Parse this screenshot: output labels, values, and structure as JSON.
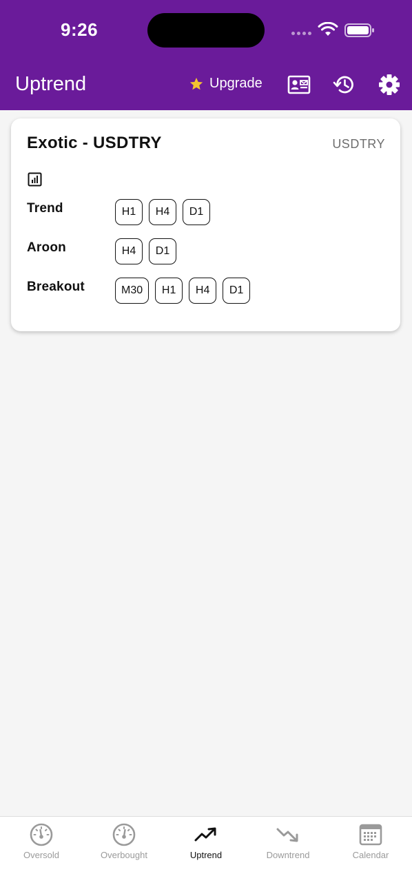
{
  "status_bar": {
    "time": "9:26"
  },
  "header": {
    "title": "Uptrend",
    "upgrade_label": "Upgrade",
    "icons": [
      "contact-card-icon",
      "history-icon",
      "gear-icon"
    ],
    "background_color": "#6a1b9a"
  },
  "card": {
    "title": "Exotic - USDTRY",
    "symbol": "USDTRY",
    "rows": [
      {
        "label": "Trend",
        "chips": [
          "H1",
          "H4",
          "D1"
        ]
      },
      {
        "label": "Aroon",
        "chips": [
          "H4",
          "D1"
        ]
      },
      {
        "label": "Breakout",
        "chips": [
          "M30",
          "H1",
          "H4",
          "D1"
        ]
      }
    ]
  },
  "bottom_nav": {
    "items": [
      {
        "label": "Oversold",
        "icon": "gauge-icon"
      },
      {
        "label": "Overbought",
        "icon": "gauge-icon"
      },
      {
        "label": "Uptrend",
        "icon": "trending-up-icon"
      },
      {
        "label": "Downtrend",
        "icon": "trending-down-icon"
      },
      {
        "label": "Calendar",
        "icon": "calendar-icon"
      }
    ],
    "active": "Uptrend"
  }
}
